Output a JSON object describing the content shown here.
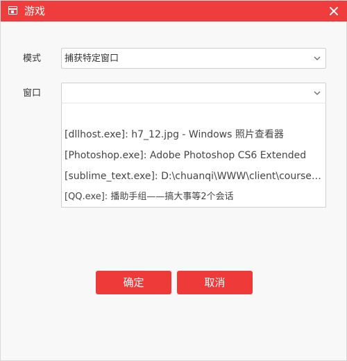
{
  "dialog": {
    "title": "游戏",
    "icon": "window-icon",
    "close_icon": "close-icon"
  },
  "form": {
    "mode_label": "模式",
    "mode_value": "捕获特定窗口",
    "window_label": "窗口",
    "window_value": ""
  },
  "window_options": [
    "",
    "[dllhost.exe]: h7_12.jpg - Windows 照片查看器",
    "[Photoshop.exe]: Adobe Photoshop CS6 Extended",
    "[sublime_text.exe]: D:\\chuanqi\\WWW\\client\\course-te...",
    "[QQ.exe]: 播助手组——搞大事等2个会话"
  ],
  "buttons": {
    "ok": "确定",
    "cancel": "取消"
  },
  "colors": {
    "accent": "#ef3d3d",
    "button": "#ef3a3a",
    "background": "#f8f8f8"
  }
}
